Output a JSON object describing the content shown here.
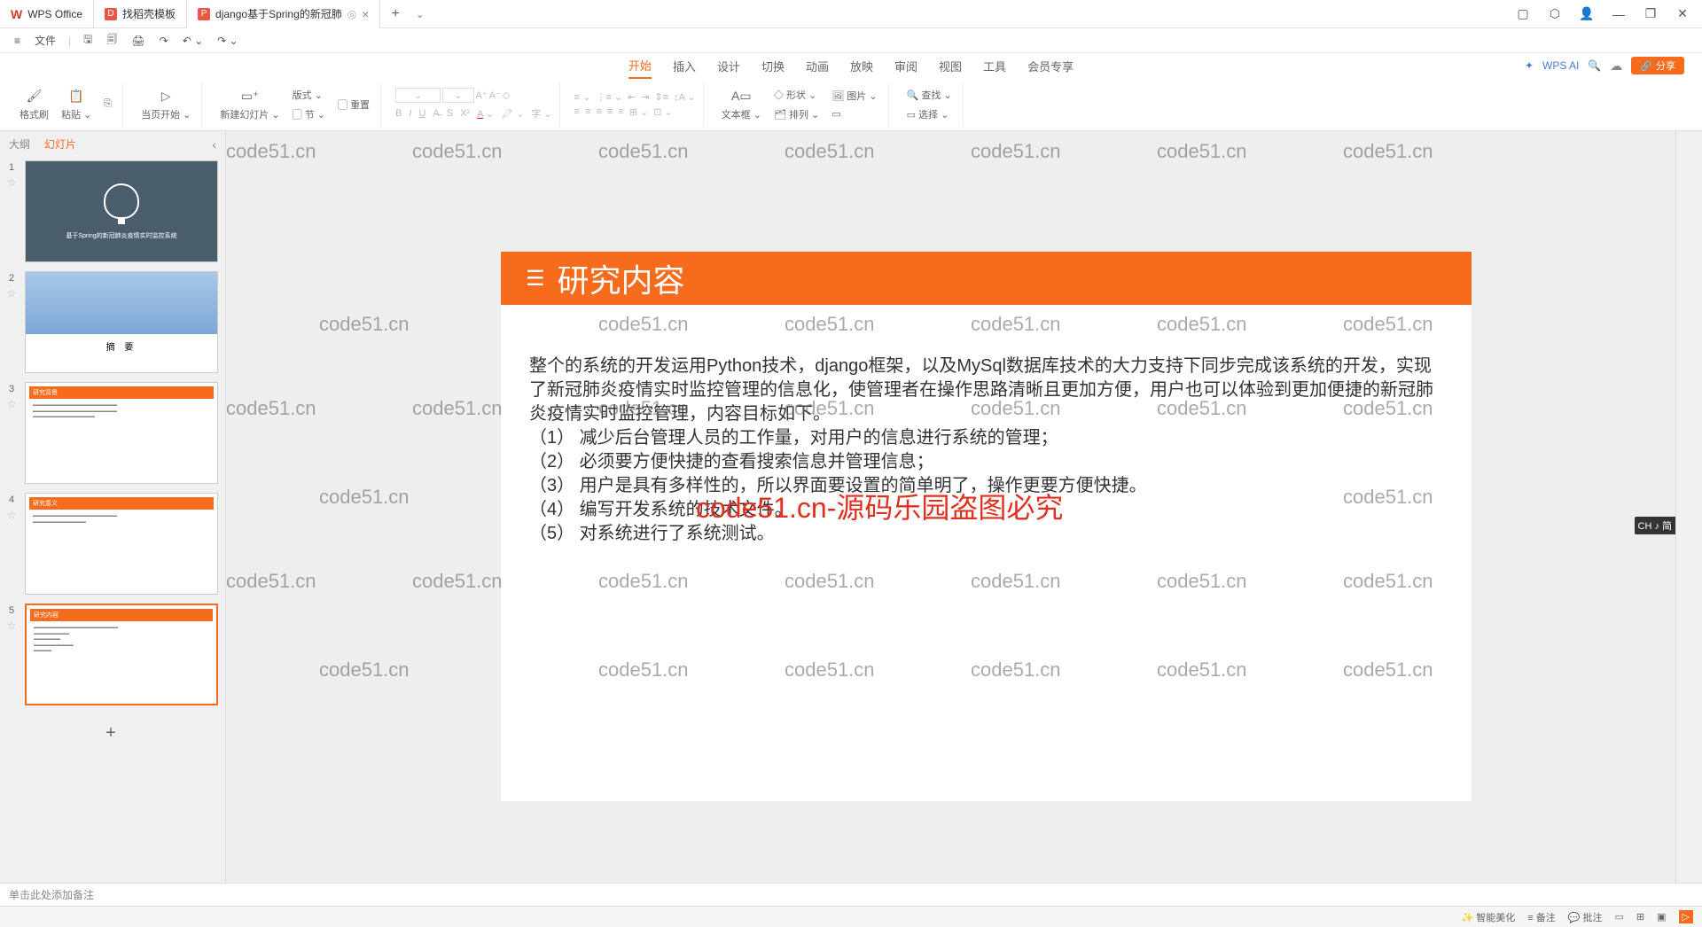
{
  "tabs": {
    "items": [
      {
        "label": "WPS Office",
        "icon": "W"
      },
      {
        "label": "找稻壳模板",
        "icon": "D"
      },
      {
        "label": "django基于Spring的新冠肺",
        "icon": "P"
      }
    ],
    "add": "+"
  },
  "window_controls": {
    "min": "—",
    "max": "❐",
    "close": "✕"
  },
  "menu_bar": {
    "file": "文件"
  },
  "ribbon_tabs": {
    "items": [
      "开始",
      "插入",
      "设计",
      "切换",
      "动画",
      "放映",
      "审阅",
      "视图",
      "工具",
      "会员专享"
    ],
    "active": "开始",
    "ai_label": "WPS AI",
    "share": "分享"
  },
  "ribbon": {
    "format_painter": "格式刷",
    "paste": "粘贴",
    "from_current": "当页开始",
    "new_slide": "新建幻灯片",
    "layout": "版式",
    "section": "节",
    "reset": "重置",
    "textbox": "文本框",
    "shapes": "形状",
    "arrange": "排列",
    "pictures": "图片",
    "find": "查找",
    "select": "选择"
  },
  "sidebar_tabs": {
    "outline": "大纲",
    "slides": "幻灯片",
    "active": "幻灯片"
  },
  "slides": {
    "s1_title": "基于Spring的新冠肺炎疫情实时监控系统",
    "s2_title": "摘  要",
    "s3_title": "研究背景",
    "s4_title": "研究意义",
    "s5_title": "研究内容"
  },
  "current_slide": {
    "title": "研究内容",
    "para1": "整个的系统的开发运用Python技术，django框架，以及MySql数据库技术的大力支持下同步完成该系统的开发，实现了新冠肺炎疫情实时监控管理的信息化，使管理者在操作思路清晰且更加方便，用户也可以体验到更加便捷的新冠肺炎疫情实时监控管理，内容目标如下。",
    "line1": "（1） 减少后台管理人员的工作量，对用户的信息进行系统的管理；",
    "line2": "（2） 必须要方便快捷的查看搜索信息并管理信息；",
    "line3": "（3）  用户是具有多样性的，所以界面要设置的简单明了，操作更要方便快捷。",
    "line4": "（4） 编写开发系统的技术文件。",
    "line5": "（5） 对系统进行了系统测试。"
  },
  "watermarks": {
    "text": "code51.cn",
    "red_text": "code51.cn-源码乐园盗图必究"
  },
  "notes_placeholder": "单击此处添加备注",
  "ime": "CH ♪ 简",
  "status": {
    "smart_beautify": "智能美化",
    "notes": "备注",
    "comments": "批注"
  }
}
